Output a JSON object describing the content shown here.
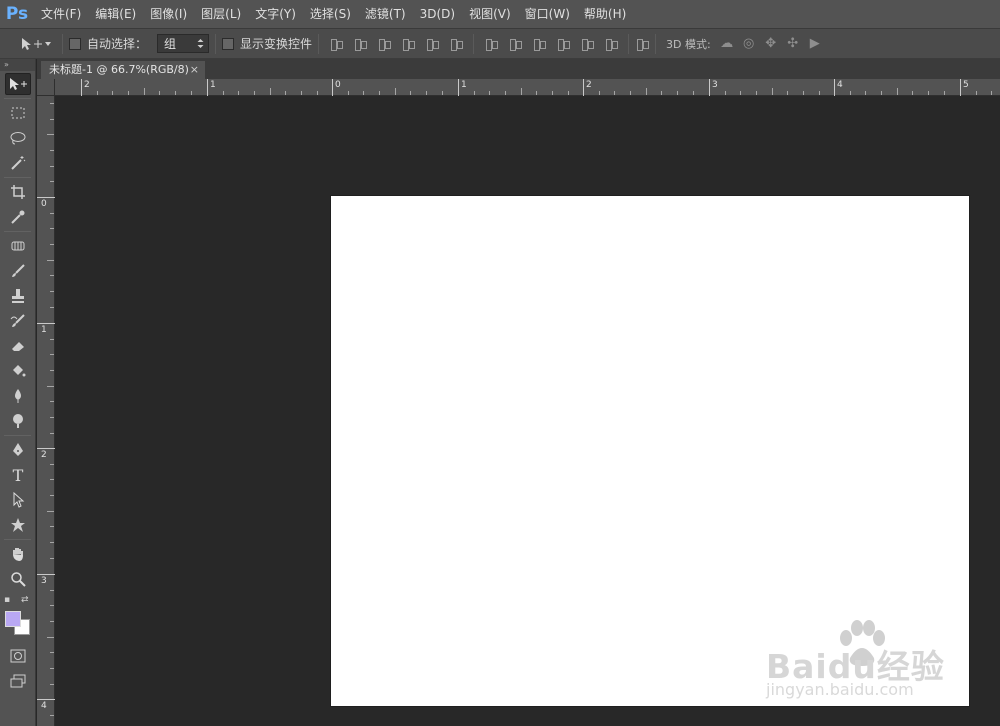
{
  "app": {
    "logo": "Ps"
  },
  "menu": [
    "文件(F)",
    "编辑(E)",
    "图像(I)",
    "图层(L)",
    "文字(Y)",
    "选择(S)",
    "滤镜(T)",
    "3D(D)",
    "视图(V)",
    "窗口(W)",
    "帮助(H)"
  ],
  "options": {
    "auto_select_label": "自动选择：",
    "auto_select_value": "组",
    "transform_label": "显示变换控件",
    "mode_label": "3D 模式:"
  },
  "document": {
    "tab_title": "未标题-1 @ 66.7%(RGB/8)",
    "close": "×"
  },
  "rulers": {
    "top_labels": [
      "2",
      "1",
      "0",
      "1",
      "2",
      "3",
      "4",
      "5"
    ],
    "left_labels": [
      "0",
      "1",
      "2",
      "3",
      "4"
    ]
  },
  "colors": {
    "foreground": "#b9a8f3",
    "background": "#ffffff",
    "canvas": "#ffffff"
  },
  "tools": [
    "move-tool",
    "marquee-tool",
    "lasso-tool",
    "magic-wand-tool",
    "crop-tool",
    "eyedropper-tool",
    "healing-tool",
    "brush-tool",
    "stamp-tool",
    "history-brush-tool",
    "eraser-tool",
    "paint-bucket-tool",
    "blur-tool",
    "dodge-tool",
    "pen-tool",
    "type-tool",
    "path-select-tool",
    "shape-tool",
    "hand-tool",
    "zoom-tool"
  ],
  "type_tool_glyph": "T",
  "watermark": {
    "logo": "Baidu经验",
    "url": "jingyan.baidu.com"
  }
}
